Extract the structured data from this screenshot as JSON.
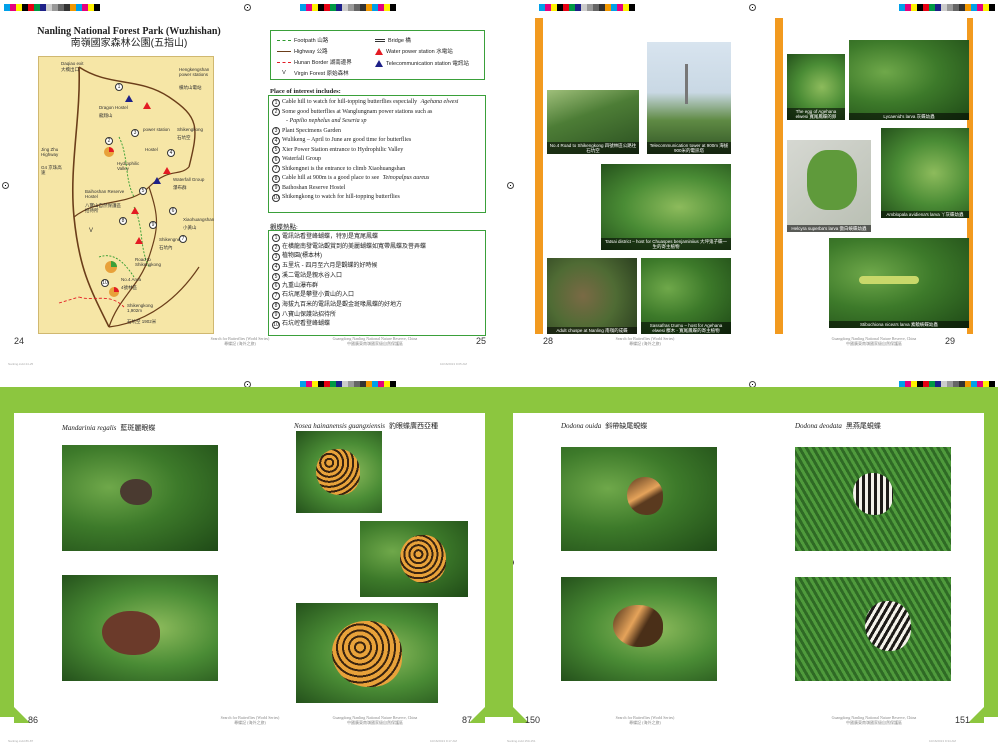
{
  "map_page": {
    "title_en": "Nanling National Forest Park (Wuzhishan)",
    "title_cn": "南嶺國家森林公園(五指山)",
    "page_number": "24",
    "labels": {
      "daqiao_exit": "Daqiao exit",
      "daqiao_cn": "大橋出口",
      "jing_zhu": "Jing Zhu Highway",
      "g4": "G4 京珠高速",
      "hengkengshan": "Hengkengshan power stations",
      "hengkengshan_cn": "橫坑山電站",
      "dragon_hostel": "Dragon Hostel",
      "dragon_hostel_cn": "龍翔山",
      "power_station": "power station",
      "shikengkong": "Shikengkong",
      "shikengkong_cn": "石坑空",
      "hostel": "Hostel",
      "hydrophilic": "Hydrophilic Valley",
      "waterfall": "Waterfall Group",
      "waterfall_cn": "瀑布群",
      "baihoshan": "Baihoshan Reserve Hostel",
      "baihoshan_cn": "八寶山自然保護區招待所",
      "xiaohuangshan": "Xiaohuangshan",
      "xiaohuangshan_cn": "小黃山",
      "shikengnei": "Shikengnei",
      "shikengnei_cn": "石坑內",
      "road_shikengkong": "Road to Shikengkong",
      "no4_area": "No.4 Area",
      "no4_area_cn": "4號林區",
      "shikengkong_road": "Shikengkong 1,902m",
      "shikengkong_road_cn": "石坑空 1902米",
      "v": "V"
    }
  },
  "legend_page": {
    "page_number": "25",
    "legend": [
      {
        "label": "Footpath 山路"
      },
      {
        "label": "Highway 公路"
      },
      {
        "label": "Hunan Border 湖南邊界"
      },
      {
        "label": "Virgin Forest 原始森林",
        "mark": "V"
      },
      {
        "label": "Bridge 橋"
      },
      {
        "label": "Water power station 水電站"
      },
      {
        "label": "Telecommunication station 電訊站"
      }
    ],
    "poi_title": "Place of interest includes:",
    "poi": [
      {
        "n": "1",
        "text": "Cable hill to watch for hill-topping butterflies especially ",
        "italic": "Agehana elwesi"
      },
      {
        "n": "2",
        "text": "Some good butterflies at Wanglungnam power stations such as",
        "italic": ""
      },
      {
        "n": "",
        "text": "- ",
        "italic": "Papilio nephelus and Seseria sp"
      },
      {
        "n": "3",
        "text": "Plant Specimens Garden",
        "italic": ""
      },
      {
        "n": "4",
        "text": "Wulikeng – April to June are good time for butterflies",
        "italic": ""
      },
      {
        "n": "5",
        "text": "Xier Power Station entrance to Hydrophilic Valley",
        "italic": ""
      },
      {
        "n": "6",
        "text": "Waterfall Group",
        "italic": ""
      },
      {
        "n": "7",
        "text": "Shikengnei is the entrance to climb Xiaohuangshan",
        "italic": ""
      },
      {
        "n": "8",
        "text": "Cable hill at 900m is a good place to see ",
        "italic": "Teinopalpus aureus"
      },
      {
        "n": "9",
        "text": "Baihoshan Reserve Hostel",
        "italic": ""
      },
      {
        "n": "10",
        "text": "Shikengkong to watch for hill-topping butterflies",
        "italic": ""
      }
    ],
    "cn_title": "觀蝶熱點:",
    "cn_poi": [
      {
        "n": "1",
        "text": "電訊站看登峰蝴蝶，特別是寬尾鳳蝶"
      },
      {
        "n": "2",
        "text": "在橫龍南發電站觀賞到的美麗蝴蝶如寬帶鳳蝶及菩弄蝶"
      },
      {
        "n": "3",
        "text": "植物園(標本林)"
      },
      {
        "n": "4",
        "text": "五里坑 - 四月至六月是觀蝶的好時候"
      },
      {
        "n": "5",
        "text": "溪二電站是親水谷入口"
      },
      {
        "n": "6",
        "text": "九重山瀑布群"
      },
      {
        "n": "7",
        "text": "石坑尾是攀登小黃山的入口"
      },
      {
        "n": "8",
        "text": "海拔九百米的電訊站是觀金斑喙鳳蝶的好地方"
      },
      {
        "n": "9",
        "text": "八寶山保護站招待所"
      },
      {
        "n": "10",
        "text": "石坑崆看登峰蝴蝶"
      }
    ],
    "footer_en": "Guangdong Nanling National Nature Reserve, China",
    "footer_cn": "中國廣東南嶺國家級自然保護區",
    "footer_left_en": "Search for Butterflies (World Series)",
    "footer_left_cn": "尋蝶記 (海外之旅)",
    "slug": "Nanling.indd 24-25",
    "slug_right": "10/16/2013 9:05 AM"
  },
  "photo_page_28": {
    "page_number": "28",
    "captions": [
      "No.4 Road to Shikengkong 四號林區公路往石坑空",
      "Telecommunication tower at 900m 海拔900米的電訊塔",
      "Tatsai district – host for Chuaspes benjaminiius 大坪鬼子蝶一生的寄主植物",
      "Adult chuspe at Nanling 南嶺的成蝶",
      "Sassafras tzumu – host for Agehana elwesi 檫木 - 寬尾鳳蝶的寄主植物"
    ]
  },
  "photo_page_29": {
    "page_number": "29",
    "captions": [
      "The egg of Agehana elwesi 寬尾鳳蝶的卵",
      "Lycaenid's larva 灰蝶幼蟲",
      "Helcyra superba's larva 傲白蛺蝶幼蟲",
      "Amblopala avidiena's larva 丫灰蝶幼蟲",
      "Stibochiona nicea's larva 素饒蛺蝶幼蟲"
    ],
    "footer_en": "Guangdong Nanling National Nature Reserve, China",
    "footer_cn": "中國廣東南嶺國家級自然保護區",
    "footer_left_en": "Search for Butterflies (World Series)",
    "footer_left_cn": "尋蝶記 (海外之旅)"
  },
  "species_page_86": {
    "page_number": "86",
    "species_left": {
      "latin": "Mandarinia regalis",
      "cn": "藍斑麗眼蝶"
    },
    "species_right": {
      "latin": "Nosea hainanensis guangxiensis",
      "cn": "豹眼蝶廣西亞種"
    },
    "page_number_right": "87",
    "footer_left_en": "Search for Butterflies (World Series)",
    "footer_left_cn": "尋蝶記 (海外之旅)",
    "footer_en": "Guangdong Nanling National Nature Reserve, China",
    "footer_cn": "中國廣東南嶺國家級自然保護區",
    "slug": "Nanling.indd 86-87",
    "slug_right": "10/16/2013 9:17 AM"
  },
  "species_page_150": {
    "page_number": "150",
    "page_number_right": "151",
    "species_left": {
      "latin": "Dodona ouida",
      "cn": "斜帶缺尾蜆蝶"
    },
    "species_right": {
      "latin": "Dodona deodata",
      "cn": "黑燕尾蜆蝶"
    },
    "footer_left_en": "Search for Butterflies (World Series)",
    "footer_left_cn": "尋蝶記 (海外之旅)",
    "footer_en": "Guangdong Nanling National Nature Reserve, China",
    "footer_cn": "中國廣東南嶺國家級自然保護區",
    "slug": "Nanling.indd 150-151",
    "slug_right": "10/16/2013 9:34 AM"
  },
  "colors": {
    "accent_green": "#8cc63f",
    "box_green": "#3aa03a",
    "orange": "#f29a1f",
    "map_yellow": "#f6e6a6"
  },
  "swatches": [
    "#00a0e9",
    "#e4007f",
    "#fff100",
    "#000000",
    "#e60012",
    "#009944",
    "#1d2088",
    "#cccccc",
    "#999999",
    "#666666",
    "#333333",
    "#f39800",
    "#00a0e9",
    "#e4007f",
    "#fff100",
    "#000000"
  ]
}
